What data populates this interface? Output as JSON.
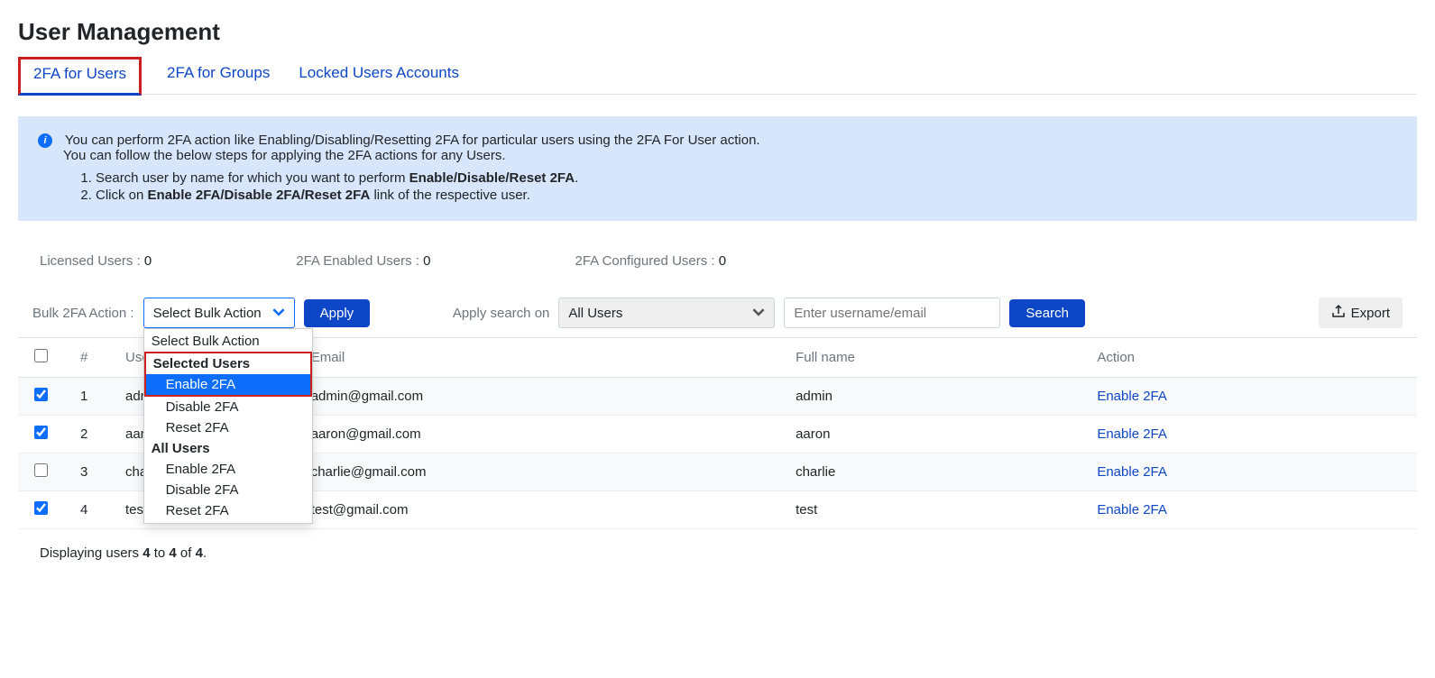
{
  "page_title": "User Management",
  "tabs": [
    {
      "label": "2FA for Users",
      "active": true
    },
    {
      "label": "2FA for Groups",
      "active": false
    },
    {
      "label": "Locked Users Accounts",
      "active": false
    }
  ],
  "banner": {
    "line1": "You can perform 2FA action like Enabling/Disabling/Resetting 2FA for particular users using the 2FA For User action.",
    "line2": "You can follow the below steps for applying the 2FA actions for any Users.",
    "step1_pre": "Search user by name for which you want to perform ",
    "step1_bold": "Enable/Disable/Reset 2FA",
    "step1_post": ".",
    "step2_pre": "Click on ",
    "step2_bold": "Enable 2FA/Disable 2FA/Reset 2FA",
    "step2_post": " link of the respective user."
  },
  "stats": {
    "licensed_label": "Licensed Users : ",
    "licensed_val": "0",
    "enabled_label": "2FA Enabled Users : ",
    "enabled_val": "0",
    "configured_label": "2FA Configured Users : ",
    "configured_val": "0"
  },
  "controls": {
    "bulk_label": "Bulk 2FA Action :",
    "bulk_selected": "Select Bulk Action",
    "apply_label": "Apply",
    "apply_search_label": "Apply search on",
    "scope_selected": "All Users",
    "search_placeholder": "Enter username/email",
    "search_btn": "Search",
    "export_label": "Export"
  },
  "dropdown": {
    "top_option": "Select Bulk Action",
    "group1": "Selected Users",
    "group1_opts": [
      "Enable 2FA",
      "Disable 2FA",
      "Reset 2FA"
    ],
    "group2": "All Users",
    "group2_opts": [
      "Enable 2FA",
      "Disable 2FA",
      "Reset 2FA"
    ]
  },
  "table": {
    "headers": {
      "idx": "#",
      "username": "Use",
      "email": "Email",
      "fullname": "Full name",
      "action": "Action"
    },
    "rows": [
      {
        "checked": true,
        "idx": "1",
        "username": "adr",
        "email": "admin@gmail.com",
        "fullname": "admin",
        "action": "Enable 2FA"
      },
      {
        "checked": true,
        "idx": "2",
        "username": "aar",
        "email": "aaron@gmail.com",
        "fullname": "aaron",
        "action": "Enable 2FA"
      },
      {
        "checked": false,
        "idx": "3",
        "username": "cha",
        "email": "charlie@gmail.com",
        "fullname": "charlie",
        "action": "Enable 2FA"
      },
      {
        "checked": true,
        "idx": "4",
        "username": "tes",
        "email": "test@gmail.com",
        "fullname": "test",
        "action": "Enable 2FA"
      }
    ]
  },
  "footer": {
    "pre": "Displaying users ",
    "from": "4",
    "mid": " to ",
    "to": "4",
    "of_pre": " of ",
    "total": "4",
    "post": "."
  }
}
